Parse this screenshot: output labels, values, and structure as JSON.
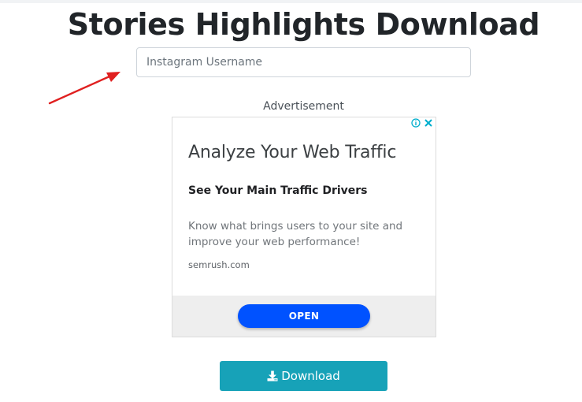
{
  "page": {
    "title": "Stories Highlights Download"
  },
  "search": {
    "placeholder": "Instagram Username",
    "value": ""
  },
  "ad": {
    "label": "Advertisement",
    "headline": "Analyze Your Web Traffic",
    "subheadline": "See Your Main Traffic Drivers",
    "body": "Know what brings users to your site and improve your web performance!",
    "domain": "semrush.com",
    "cta_label": "OPEN",
    "icons": [
      "info-icon",
      "close-icon"
    ]
  },
  "actions": {
    "download_label": "Download",
    "download_icon": "download-icon"
  },
  "colors": {
    "accent": "#17a2b8",
    "ad_cta": "#0052ff",
    "annotation_arrow": "#e02020"
  }
}
